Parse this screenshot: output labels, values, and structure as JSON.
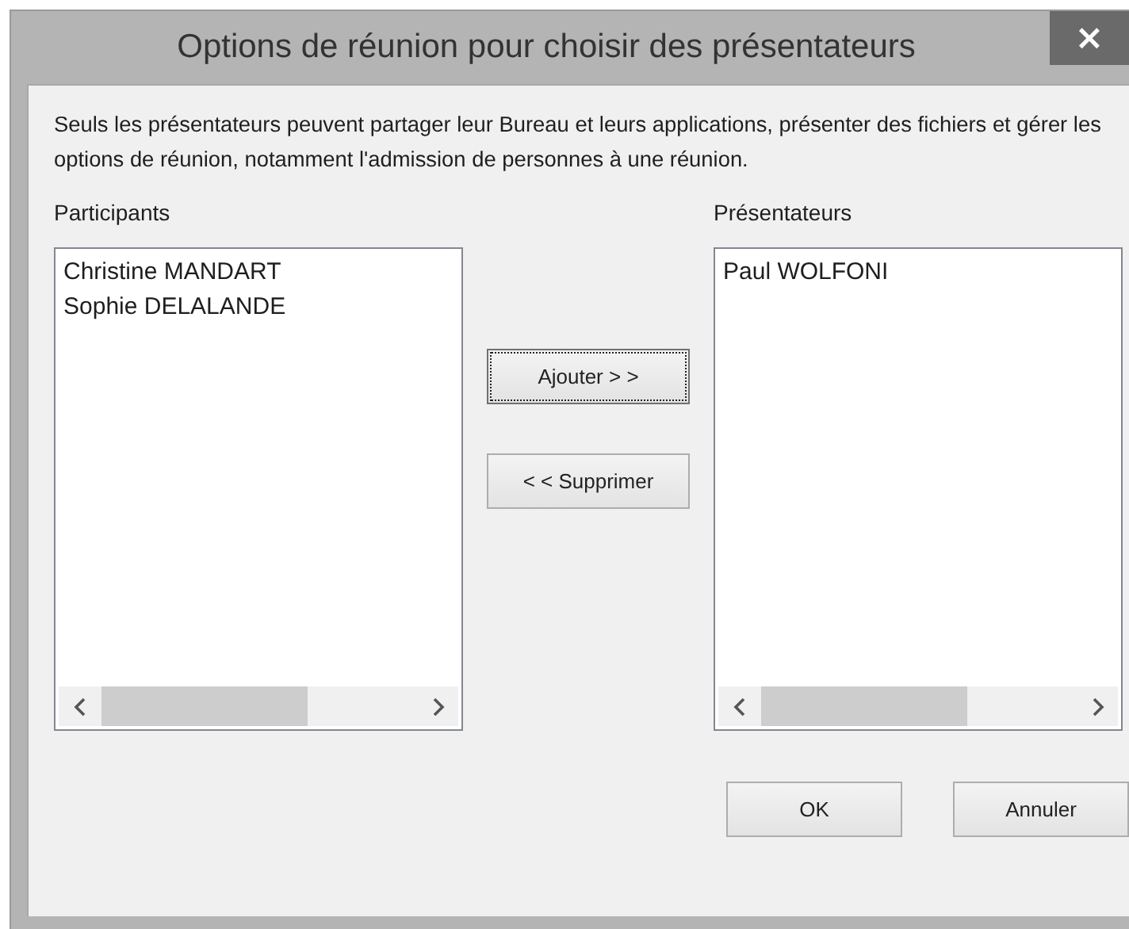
{
  "window": {
    "title": "Options de réunion pour choisir des présentateurs",
    "close": "×"
  },
  "description": "Seuls les présentateurs peuvent partager leur Bureau et leurs applications, présenter des fichiers et gérer les options de réunion, notamment l'admission de personnes à une réunion.",
  "participants": {
    "label": "Participants",
    "items": [
      "Christine MANDART",
      "Sophie DELALANDE"
    ]
  },
  "move_buttons": [
    {
      "label": "Ajouter > >",
      "focused": true
    },
    {
      "label": "< < Supprimer",
      "focused": false
    }
  ],
  "presenters": {
    "label": "Présentateurs",
    "items": [
      "Paul WOLFONI"
    ]
  },
  "buttons": [
    "OK",
    "Annuler"
  ]
}
